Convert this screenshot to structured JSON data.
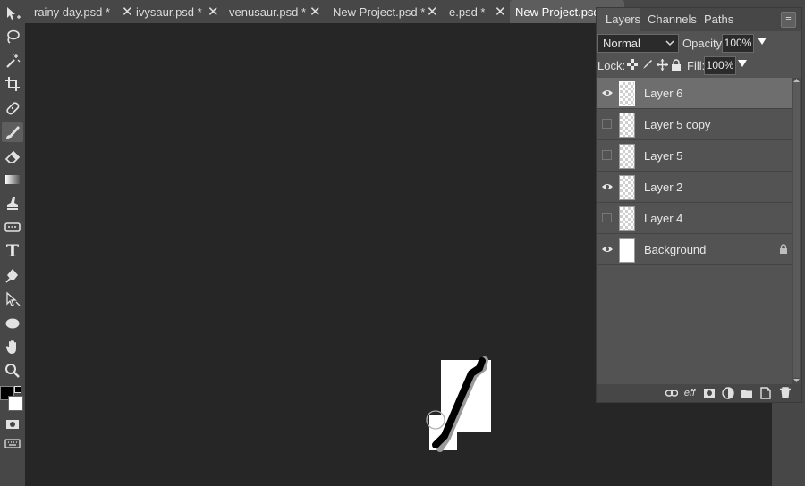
{
  "tabs": [
    {
      "label": "rainy day.psd *"
    },
    {
      "label": "ivysaur.psd *"
    },
    {
      "label": "venusaur.psd *"
    },
    {
      "label": "New Project.psd *"
    },
    {
      "label": "e.psd *"
    },
    {
      "label": "New Project.psd *"
    }
  ],
  "tab_close_glyph": "✕",
  "toolbar": {
    "tools": [
      "move-tool-icon",
      "lasso-tool-icon",
      "magic-wand-icon",
      "crop-tool-icon",
      "healing-brush-icon",
      "brush-tool-icon",
      "eraser-tool-icon",
      "gradient-tool-icon",
      "clone-stamp-icon",
      "smudge-tool-icon",
      "type-tool-icon",
      "pen-tool-icon",
      "path-select-icon",
      "ellipse-tool-icon",
      "hand-tool-icon",
      "zoom-tool-icon"
    ],
    "active_tool": "brush-tool-icon",
    "type_glyph": "T",
    "foreground_color": "#000000",
    "background_color": "#ffffff"
  },
  "panel": {
    "tabs": [
      "Layers",
      "Channels",
      "Paths"
    ],
    "active_tab": "Layers",
    "menu_glyph": "≡",
    "blend_mode": "Normal",
    "opacity_label": "Opacity:",
    "opacity_value": "100%",
    "lock_label": "Lock:",
    "fill_label": "Fill:",
    "fill_value": "100%",
    "layers": [
      {
        "name": "Layer 6",
        "visible": true,
        "selected": true
      },
      {
        "name": "Layer 5 copy",
        "visible": false,
        "selected": false
      },
      {
        "name": "Layer 5",
        "visible": false,
        "selected": false
      },
      {
        "name": "Layer 2",
        "visible": true,
        "selected": false
      },
      {
        "name": "Layer 4",
        "visible": false,
        "selected": false
      },
      {
        "name": "Background",
        "visible": true,
        "selected": false,
        "locked": true
      }
    ],
    "footer_icons": [
      "link-layers-icon",
      "effects-icon",
      "mask-icon",
      "adjustment-icon",
      "folder-icon",
      "new-layer-icon",
      "delete-layer-icon"
    ],
    "effects_label": "eff"
  },
  "colors": {
    "workspace": "#262626",
    "chrome": "#474747",
    "panel": "#535353",
    "selected_row": "#6e6e6e"
  }
}
